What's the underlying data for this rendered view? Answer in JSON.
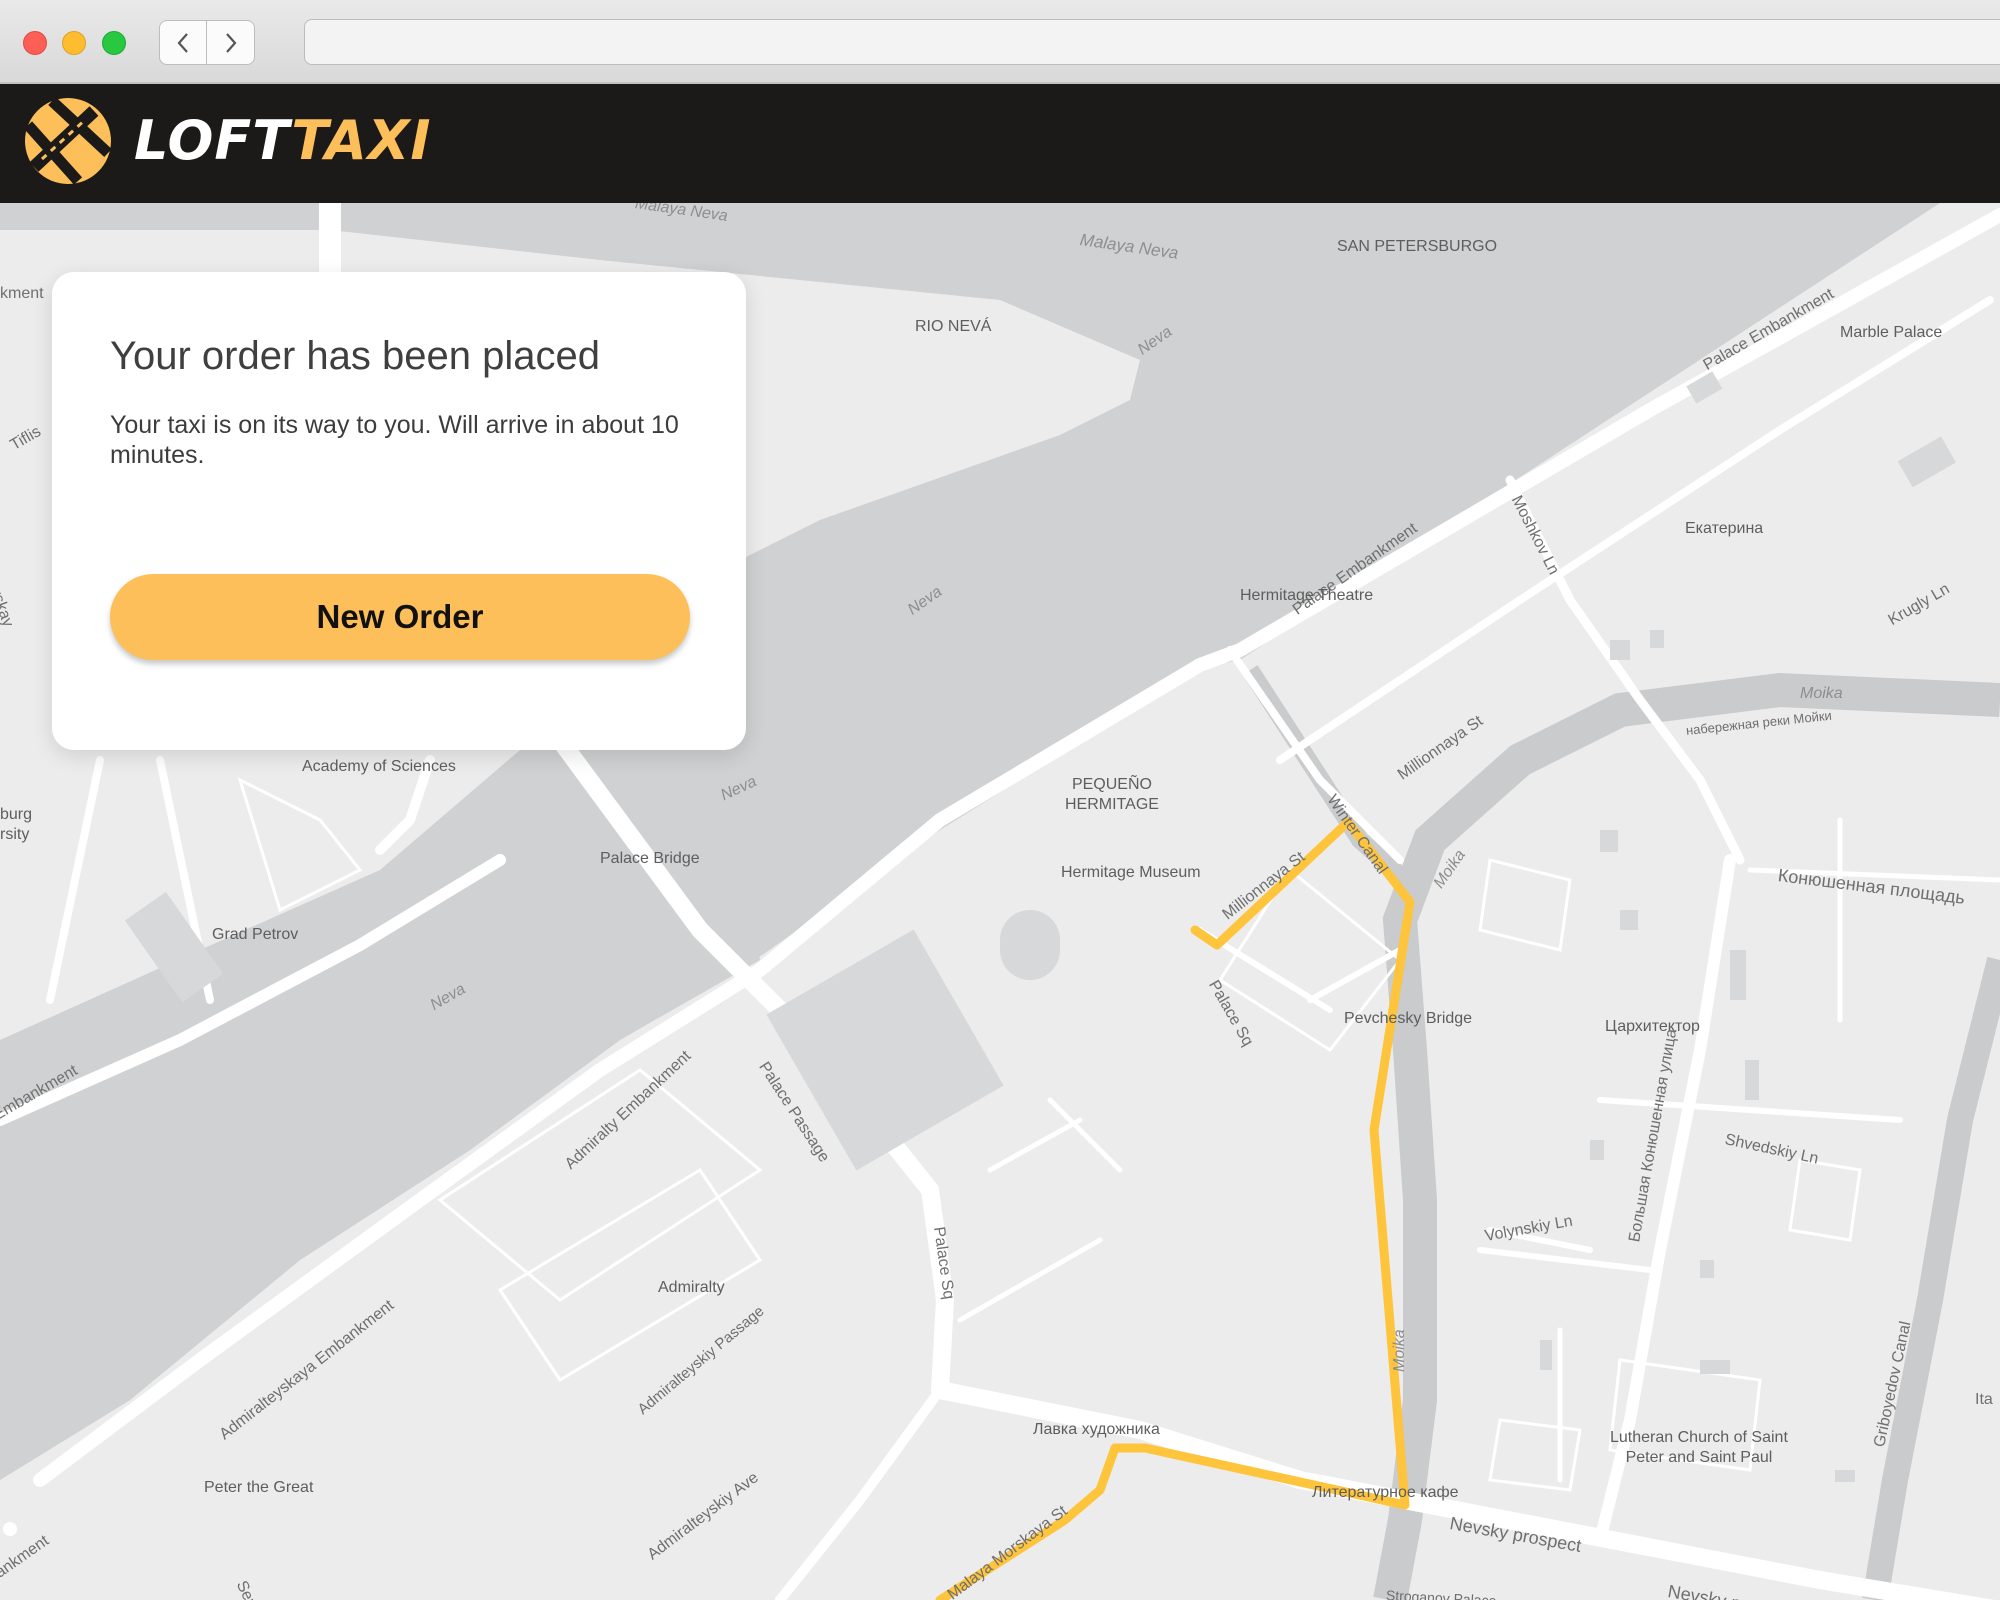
{
  "browser": {
    "back_icon": "chevron-left-icon",
    "forward_icon": "chevron-right-icon",
    "address_value": ""
  },
  "header": {
    "logo_icon": "taxi-road-logo-icon",
    "brand_part1": "LOFT",
    "brand_part2": "TAXI",
    "brand_colors": {
      "first": "#ffffff",
      "second": "#fdbf5a"
    }
  },
  "order_card": {
    "title": "Your order has been placed",
    "message": "Your taxi is on its way to you. Will arrive in about 10 minutes.",
    "button_label": "New Order",
    "accent_color": "#fdbf5a"
  },
  "map": {
    "route_color": "#fdc43c",
    "labels": {
      "malaya_neva_top": "Malaya Neva",
      "malaya_neva": "Malaya Neva",
      "san_petersburgo": "SAN PETERSBURGO",
      "rio_neva": "RIO NEVÁ",
      "neva_1": "Neva",
      "neva_2": "Neva",
      "neva_3": "Neva",
      "neva_4": "Neva",
      "embankment_top_left": "kment",
      "tiflis": "Tiflis",
      "mendeleevskaya": "Mendeleevskay",
      "marble_palace": "Marble Palace",
      "palace_embankment_1": "Palace Embankment",
      "palace_embankment_2": "Palace Embankment",
      "moshkov_ln": "Moshkov Ln",
      "ekaterina": "Екатерина",
      "krugly_ln": "Krugly Ln",
      "hermitage_theatre": "Hermitage Theatre",
      "moika_1": "Moika",
      "moika_embankment": "набережная реки Мойки",
      "millionnaya_1": "Millionnaya St",
      "millionnaya_2": "Millionnaya St",
      "winter_canal": "Winter Canal",
      "moika_2": "Moika",
      "moika_3": "Moika",
      "pequeno_hermitage": "PEQUEÑO\nHERMITAGE",
      "hermitage_museum": "Hermitage Museum",
      "konyushennaya_sq": "Конюшенная площадь",
      "academy_of_sciences": "Academy of Sciences",
      "burg_university": "burg\nrsity",
      "palace_bridge": "Palace Bridge",
      "grad_petrov": "Grad Petrov",
      "palace_sq": "Palace Sq",
      "pevchesky_bridge": "Pevchesky Bridge",
      "tsarkhitektor": "Цархитектор",
      "bolshaya_konyushennaya": "Большая Конюшенная улица",
      "shvedskiy_ln": "Shvedskiy Ln",
      "embankment_left": "Embankment",
      "admiralty_embankment": "Admiralty Embankment",
      "palace_passage": "Palace Passage",
      "palace_sq_2": "Palace Sq",
      "volynskiy_ln": "Volynskiy Ln",
      "admiralty": "Admiralty",
      "admiralteyskiy_passage": "Admiralteyskiy Passage",
      "admiralteyskaya_embankment": "Admiralteyskaya Embankment",
      "griboyedov_canal": "Griboyedov Canal",
      "lutheran_church": "Lutheran Church of Saint\nPeter and Saint Paul",
      "lavka": "Лавка художника",
      "literary_cafe": "Литературное кафе",
      "peter_the_great": "Peter the Great",
      "admiralteyskiy_ave": "Admiralteyskiy Ave",
      "nevsky_1": "Nevsky prospect",
      "nevsky_2": "Nevsky prospect",
      "malaya_morskaya": "Malaya Morskaya St",
      "embankment_bottom_left": "bankment",
      "sen": "Sen",
      "stroganov": "Stroganov Palace",
      "ita": "Ita"
    }
  }
}
